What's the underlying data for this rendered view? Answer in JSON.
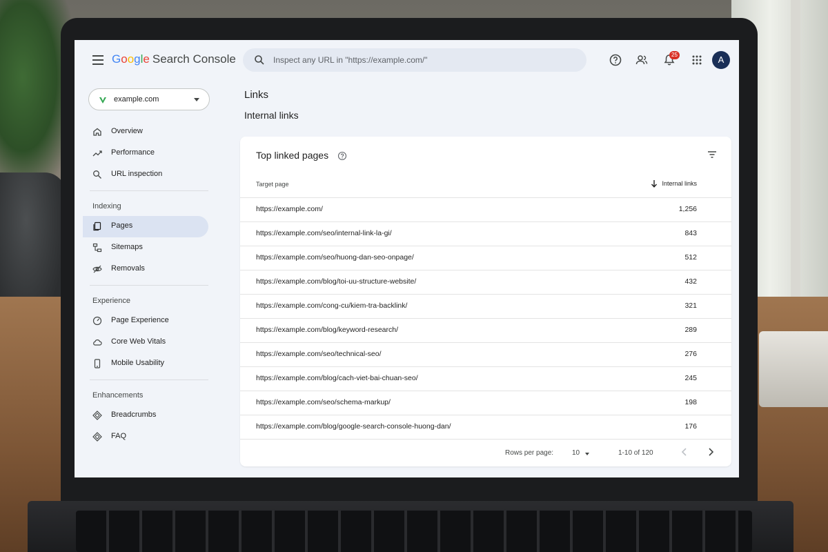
{
  "app": {
    "logo_letters": [
      "G",
      "o",
      "o",
      "g",
      "l",
      "e"
    ],
    "product": "Search Console"
  },
  "search": {
    "placeholder": "Inspect any URL in \"https://example.com/\"",
    "value": ""
  },
  "header": {
    "notification_count": "25",
    "avatar_letter": "A",
    "icons": [
      "menu-icon",
      "search-icon",
      "help-icon",
      "users-icon",
      "bell-icon",
      "apps-icon"
    ]
  },
  "property": {
    "name": "example.com"
  },
  "sidebar": {
    "top_items": [
      {
        "label": "Overview",
        "icon": "home-icon"
      },
      {
        "label": "Performance",
        "icon": "trending-icon"
      },
      {
        "label": "URL inspection",
        "icon": "search-icon"
      }
    ],
    "sections": [
      {
        "title": "Indexing",
        "items": [
          {
            "label": "Pages",
            "icon": "pages-icon",
            "active": true
          },
          {
            "label": "Sitemaps",
            "icon": "sitemap-icon"
          },
          {
            "label": "Removals",
            "icon": "removals-icon"
          }
        ]
      },
      {
        "title": "Experience",
        "items": [
          {
            "label": "Page Experience",
            "icon": "gauge-icon"
          },
          {
            "label": "Core Web Vitals",
            "icon": "cloud-icon"
          },
          {
            "label": "Mobile Usability",
            "icon": "phone-icon"
          }
        ]
      },
      {
        "title": "Enhancements",
        "items": [
          {
            "label": "Breadcrumbs",
            "icon": "diamond-icon"
          },
          {
            "label": "FAQ",
            "icon": "diamond-icon"
          }
        ]
      }
    ]
  },
  "main": {
    "title": "Links",
    "subtitle": "Internal links",
    "card": {
      "title": "Top linked pages",
      "columns": {
        "target": "Target page",
        "links": "Internal links"
      },
      "rows": [
        {
          "url": "https://example.com/",
          "links": "1,256"
        },
        {
          "url": "https://example.com/seo/internal-link-la-gi/",
          "links": "843"
        },
        {
          "url": "https://example.com/seo/huong-dan-seo-onpage/",
          "links": "512"
        },
        {
          "url": "https://example.com/blog/toi-uu-structure-website/",
          "links": "432"
        },
        {
          "url": "https://example.com/cong-cu/kiem-tra-backlink/",
          "links": "321"
        },
        {
          "url": "https://example.com/blog/keyword-research/",
          "links": "289"
        },
        {
          "url": "https://example.com/seo/technical-seo/",
          "links": "276"
        },
        {
          "url": "https://example.com/blog/cach-viet-bai-chuan-seo/",
          "links": "245"
        },
        {
          "url": "https://example.com/seo/schema-markup/",
          "links": "198"
        },
        {
          "url": "https://example.com/blog/google-search-console-huong-dan/",
          "links": "176"
        }
      ],
      "pagination": {
        "rows_per_page_label": "Rows per page:",
        "rows_per_page": "10",
        "range": "1-10 of 120"
      }
    }
  },
  "colors": {
    "accent": "#1a73e8",
    "active_nav": "#dbe3f2",
    "badge": "#d93025",
    "avatar": "#1a2f57"
  }
}
